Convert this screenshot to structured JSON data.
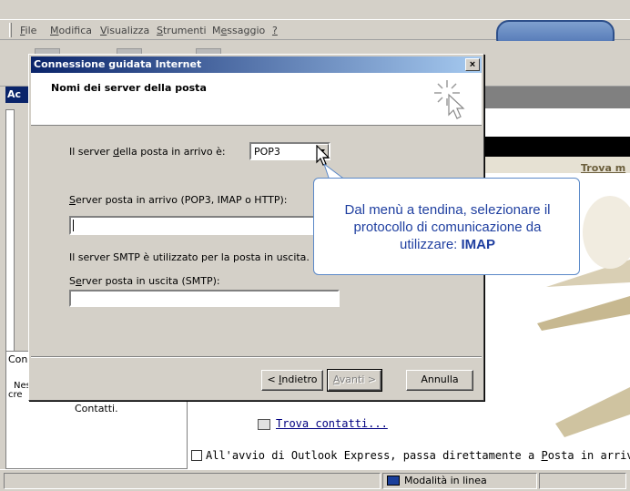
{
  "menubar": {
    "items": [
      {
        "prefix": "",
        "key": "F",
        "rest": "ile"
      },
      {
        "prefix": "",
        "key": "M",
        "rest": "odifica"
      },
      {
        "prefix": "",
        "key": "V",
        "rest": "isualizza"
      },
      {
        "prefix": "",
        "key": "S",
        "rest": "trumenti"
      },
      {
        "prefix": "M",
        "key": "e",
        "rest": "ssaggio"
      },
      {
        "prefix": "",
        "key": "?",
        "rest": ""
      }
    ]
  },
  "left_pane": {
    "header": "Ac",
    "contacts_title": "Con",
    "contacts_line1": "Nes",
    "contacts_line2": "cre",
    "contacts_label": "Contatti."
  },
  "right_pane": {
    "trova_partial": "Trova m",
    "find_contacts": "Trova contatti...",
    "startup_check_prefix": "All'avvio di Outlook Express, passa direttamente a ",
    "startup_check_key": "P",
    "startup_check_rest": "osta in arrivo"
  },
  "statusbar": {
    "online": "Modalità in linea"
  },
  "dialog": {
    "title": "Connessione guidata Internet",
    "close_label": "×",
    "header_title": "Nomi dei server della posta",
    "incoming_type_label_a": "Il server ",
    "incoming_type_label_key": "d",
    "incoming_type_label_b": "ella posta in arrivo è:",
    "incoming_type_value": "POP3",
    "incoming_server_label_key": "S",
    "incoming_server_label_rest": "erver posta in arrivo (POP3, IMAP o HTTP):",
    "incoming_server_value": "",
    "smtp_note": "Il server SMTP è utilizzato per la posta in uscita.",
    "outgoing_server_label_a": "S",
    "outgoing_server_label_key": "e",
    "outgoing_server_label_rest": "rver posta in uscita (SMTP):",
    "outgoing_server_value": "",
    "back_button": {
      "prefix": "< ",
      "key": "I",
      "rest": "ndietro"
    },
    "next_button": {
      "key": "A",
      "rest": "vanti >"
    },
    "cancel_button": "Annulla"
  },
  "callout": {
    "text": "Dal menù a tendina, selezionare il protocollo di comunicazione da utilizzare: ",
    "highlight": "IMAP"
  },
  "colors": {
    "titlebar_start": "#0a246a",
    "titlebar_end": "#a6caf0",
    "callout_text": "#1f3fa0",
    "callout_border": "#5b89c8"
  }
}
